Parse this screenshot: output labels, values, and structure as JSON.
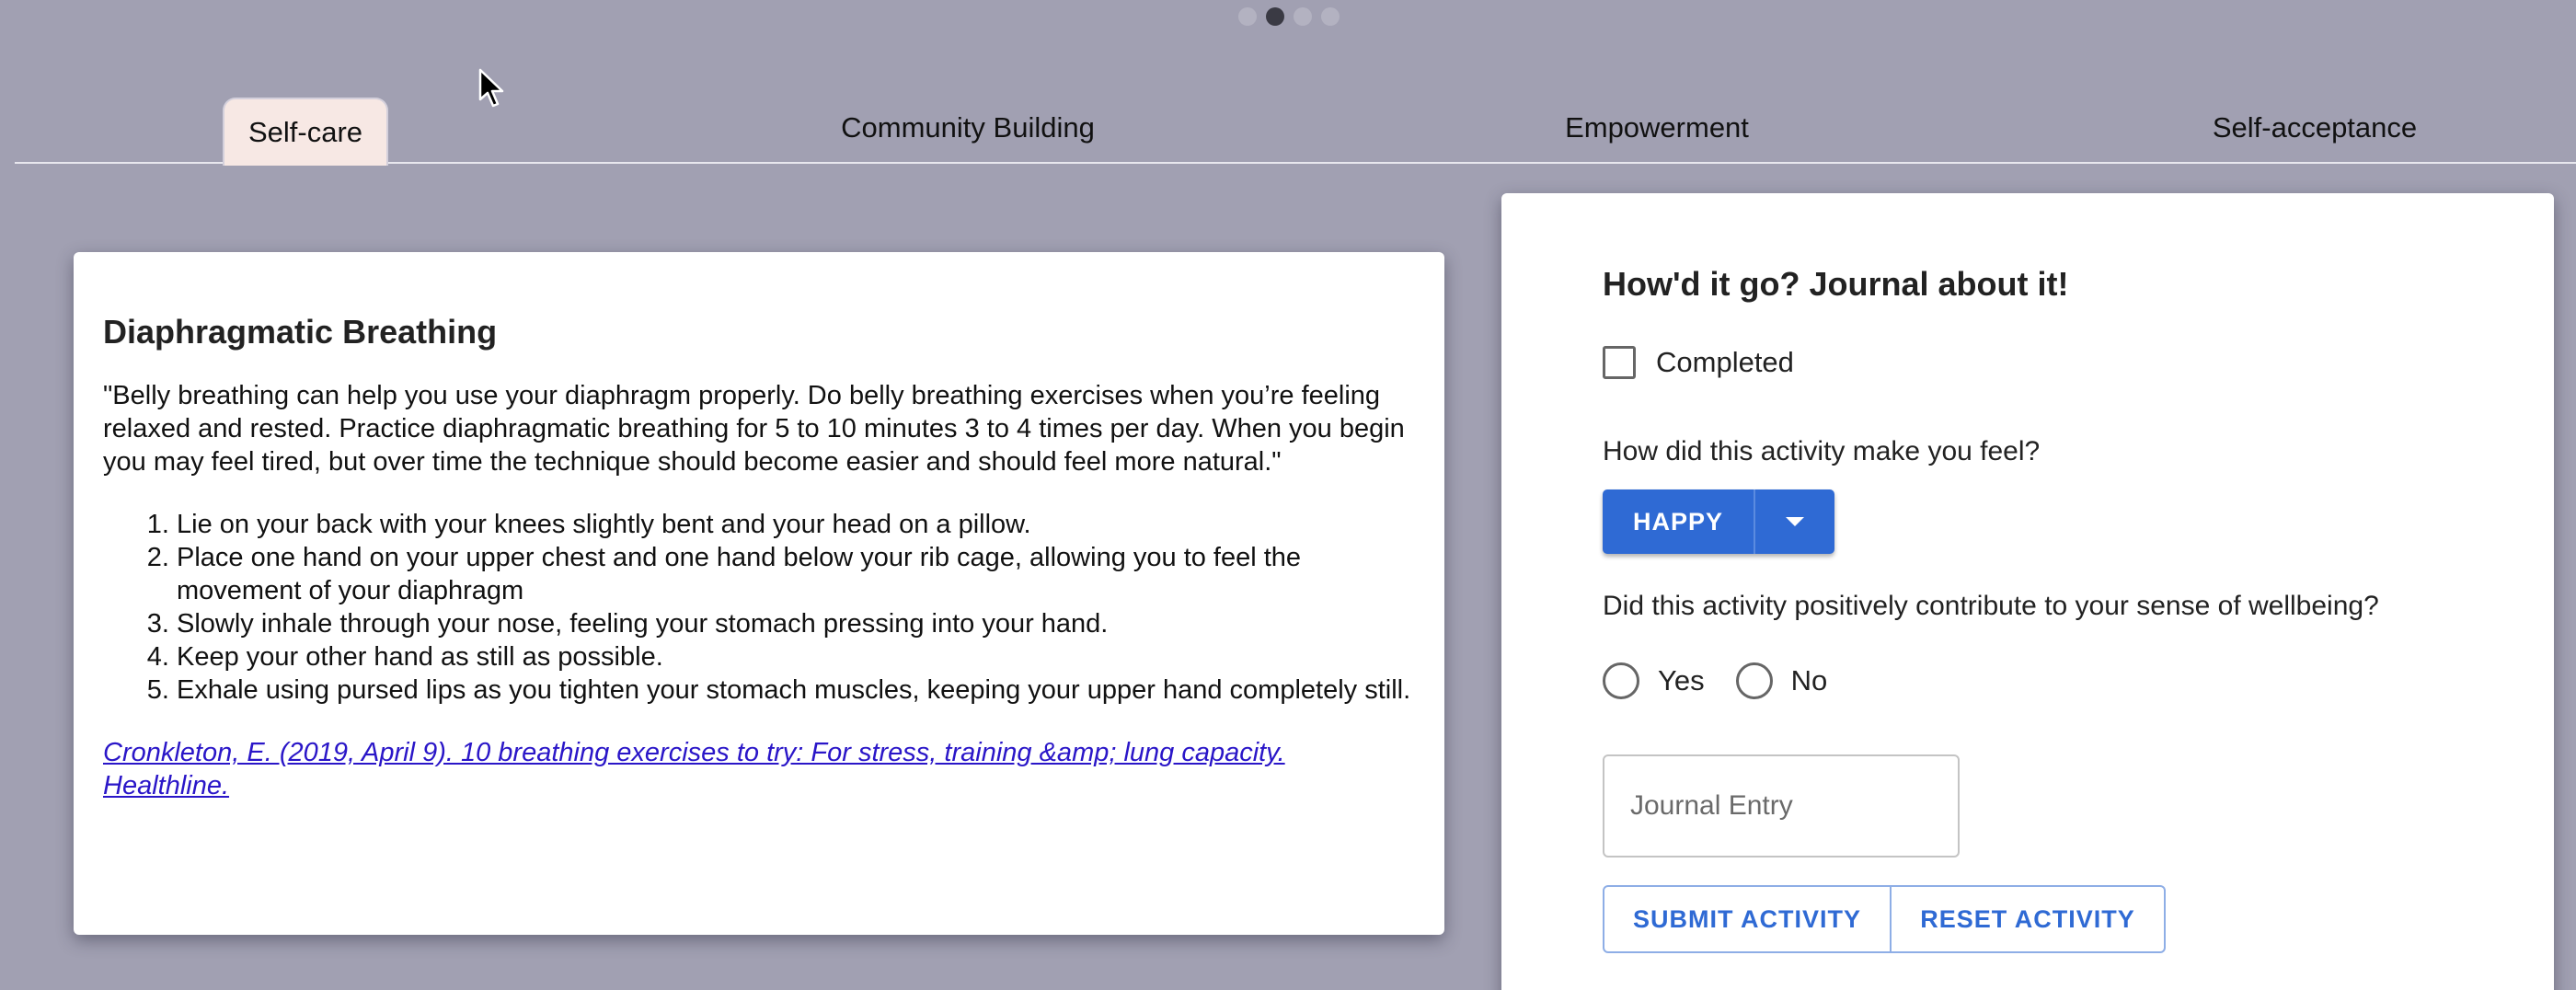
{
  "carousel": {
    "dots": [
      "inactive",
      "active",
      "inactive",
      "inactive"
    ]
  },
  "tabs": [
    {
      "label": "Self-care",
      "selected": true
    },
    {
      "label": "Community Building",
      "selected": false
    },
    {
      "label": "Empowerment",
      "selected": false
    },
    {
      "label": "Self-acceptance",
      "selected": false
    }
  ],
  "activity": {
    "title": "Diaphragmatic Breathing",
    "description": "\"Belly breathing can help you use your diaphragm properly. Do belly breathing exercises when you’re feeling relaxed and rested. Practice diaphragmatic breathing for 5 to 10 minutes 3 to 4 times per day. When you begin you may feel tired, but over time the technique should become easier and should feel more natural.\"",
    "steps": [
      "Lie on your back with your knees slightly bent and your head on a pillow.",
      "Place one hand on your upper chest and one hand below your rib cage, allowing you to feel the movement of your diaphragm",
      "Slowly inhale through your nose, feeling your stomach pressing into your hand.",
      "Keep your other hand as still as possible.",
      "Exhale using pursed lips as you tighten your stomach muscles, keeping your upper hand completely still."
    ],
    "citation": "Cronkleton, E. (2019, April 9). 10 breathing exercises to try: For stress, training &amp; lung capacity. Healthline."
  },
  "journal": {
    "heading": "How'd it go? Journal about it!",
    "completed_label": "Completed",
    "feel_question": "How did this activity make you feel?",
    "feel_selected": "HAPPY",
    "wellbeing_question": "Did this activity positively contribute to your sense of wellbeing?",
    "yes_label": "Yes",
    "no_label": "No",
    "entry_placeholder": "Journal Entry",
    "submit_label": "SUBMIT ACTIVITY",
    "reset_label": "RESET ACTIVITY"
  },
  "colors": {
    "background": "#a1a0b2",
    "primary": "#2f6ad4",
    "selected_tab": "#f7e8e4",
    "link": "#2a16c8"
  },
  "icons": {
    "cursor": "mouse-pointer-icon",
    "dropdown": "caret-down-icon"
  }
}
